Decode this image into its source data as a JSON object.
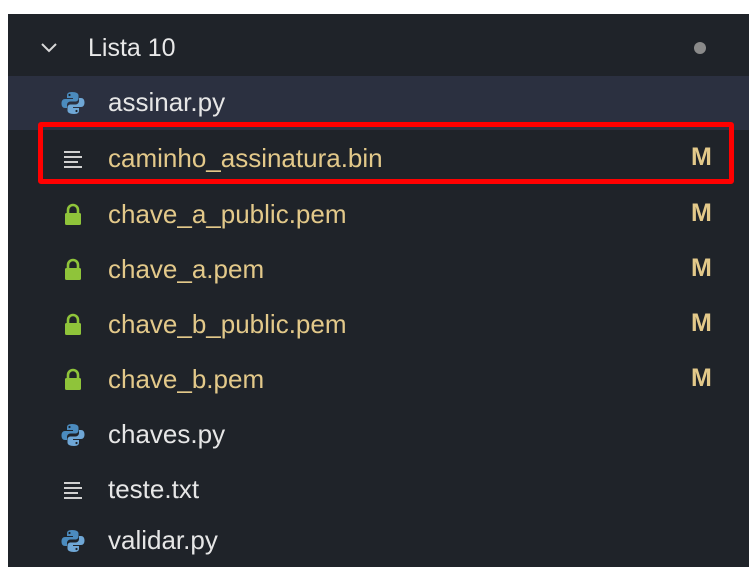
{
  "folder": {
    "label": "Lista 10",
    "expanded": true,
    "has_changes_indicator": true
  },
  "files": [
    {
      "name": "assinar.py",
      "icon": "python-icon",
      "status": "",
      "modified": false,
      "selected": true
    },
    {
      "name": "caminho_assinatura.bin",
      "icon": "lines-icon",
      "status": "M",
      "modified": true,
      "selected": false,
      "highlighted": true
    },
    {
      "name": "chave_a_public.pem",
      "icon": "lock-icon",
      "status": "M",
      "modified": true,
      "selected": false
    },
    {
      "name": "chave_a.pem",
      "icon": "lock-icon",
      "status": "M",
      "modified": true,
      "selected": false
    },
    {
      "name": "chave_b_public.pem",
      "icon": "lock-icon",
      "status": "M",
      "modified": true,
      "selected": false
    },
    {
      "name": "chave_b.pem",
      "icon": "lock-icon",
      "status": "M",
      "modified": true,
      "selected": false
    },
    {
      "name": "chaves.py",
      "icon": "python-icon",
      "status": "",
      "modified": false,
      "selected": false
    },
    {
      "name": "teste.txt",
      "icon": "lines-icon",
      "status": "",
      "modified": false,
      "selected": false
    },
    {
      "name": "validar.py",
      "icon": "python-icon",
      "status": "",
      "modified": false,
      "selected": false
    }
  ],
  "colors": {
    "background": "#1f2329",
    "selected_row": "#2b3040",
    "modified_text": "#e3c98a",
    "plain_text": "#e6e6e6",
    "highlight": "#ff0000",
    "lock": "#8fc43a",
    "python_blue": "#4b8bbe"
  }
}
